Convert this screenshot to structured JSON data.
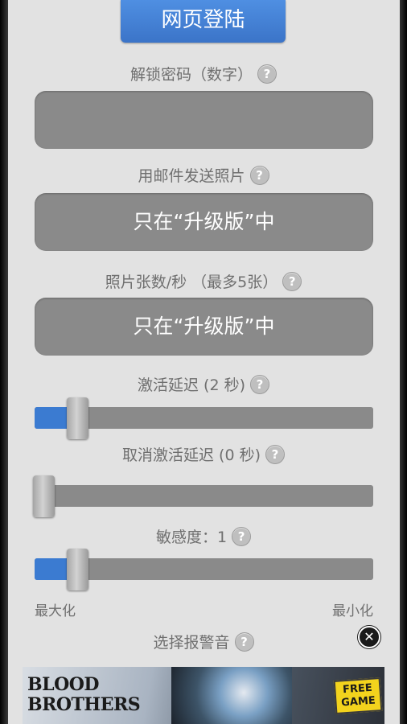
{
  "header": {
    "web_login_label": "网页登陆"
  },
  "unlock_code": {
    "label": "解锁密码（数字）",
    "help": "?",
    "value": ""
  },
  "email_photos": {
    "label": "用邮件发送照片",
    "help": "?",
    "value": "只在“升级版”中"
  },
  "photos_per_second": {
    "label": "照片张数/秒 （最多5张）",
    "help": "?",
    "value": "只在“升级版”中"
  },
  "activation_delay": {
    "label": "激活延迟 (2 秒)",
    "help": "?",
    "level": 0.08
  },
  "deactivation_delay": {
    "label": "取消激活延迟 (0 秒)",
    "help": "?",
    "level": 0.0
  },
  "sensitivity": {
    "label": "敏感度：1",
    "help": "?",
    "level": 0.08,
    "min_label": "最大化",
    "max_label": "最小化"
  },
  "alarm_sound": {
    "label": "选择报警音",
    "help": "?"
  },
  "ad": {
    "title_line1": "BLOOD",
    "title_line2": "BROTHERS",
    "badge_line1": "FREE",
    "badge_line2": "GAME",
    "close": "✕"
  },
  "colors": {
    "accent": "#3b7bd1",
    "field": "#8a8a8a",
    "panel": "#e2e2e2"
  }
}
